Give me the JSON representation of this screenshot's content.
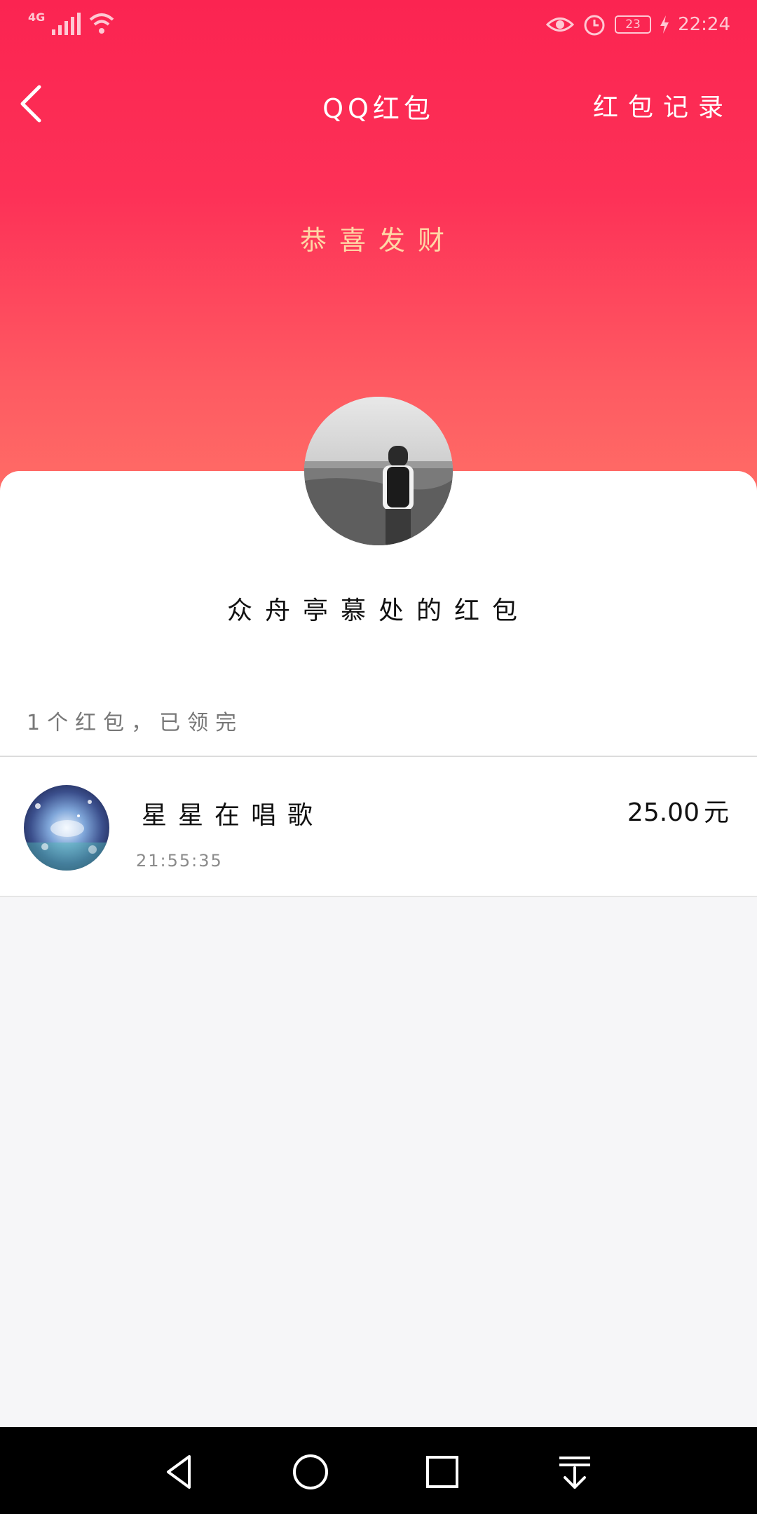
{
  "status_bar": {
    "network": "4G",
    "battery": "23",
    "time": "22:24"
  },
  "nav": {
    "title": "QQ红包",
    "right_link": "红包记录"
  },
  "greeting": "恭喜发财",
  "sender": {
    "name": "众舟亭慕处的红包"
  },
  "summary": "1个红包，已领完",
  "receivers": [
    {
      "name": "星星在唱歌",
      "time": "21:55:35",
      "amount": "25.00",
      "unit": "元"
    }
  ],
  "colors": {
    "accent": "#fb2451",
    "greeting": "#ffd7a6"
  }
}
